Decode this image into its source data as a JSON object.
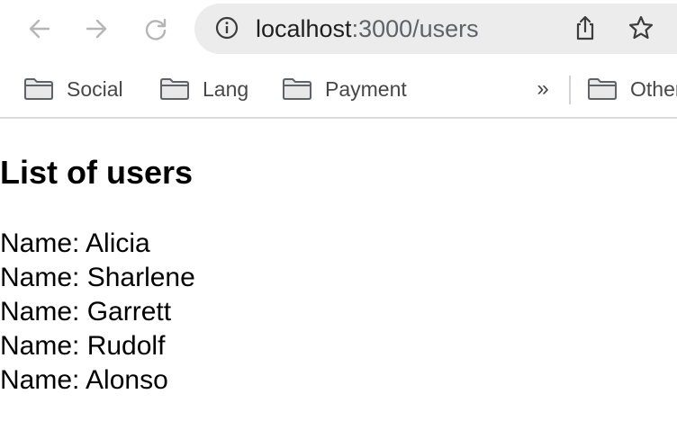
{
  "browser": {
    "url_host": "localhost",
    "url_path": ":3000/users",
    "icons": {
      "back": "arrow-left-icon",
      "forward": "arrow-right-icon",
      "reload": "reload-icon",
      "site_info": "info-circle-icon",
      "share": "share-icon",
      "bookmark_star": "star-icon",
      "folder": "folder-icon",
      "overflow": "double-chevron-right-icon"
    }
  },
  "bookmarks": {
    "items": [
      {
        "label": "Social"
      },
      {
        "label": "Lang"
      },
      {
        "label": "Payment"
      }
    ],
    "overflow_label": "»",
    "other_label": "Other"
  },
  "page": {
    "title": "List of users",
    "users": [
      {
        "text": "Name: Alicia"
      },
      {
        "text": "Name: Sharlene"
      },
      {
        "text": "Name: Garrett"
      },
      {
        "text": "Name: Rudolf"
      },
      {
        "text": "Name: Alonso"
      }
    ]
  },
  "colors": {
    "omnibox_bg": "#ececec",
    "disabled_icon": "#b5b5b5",
    "icon": "#3c3c3c",
    "text": "#000000"
  }
}
